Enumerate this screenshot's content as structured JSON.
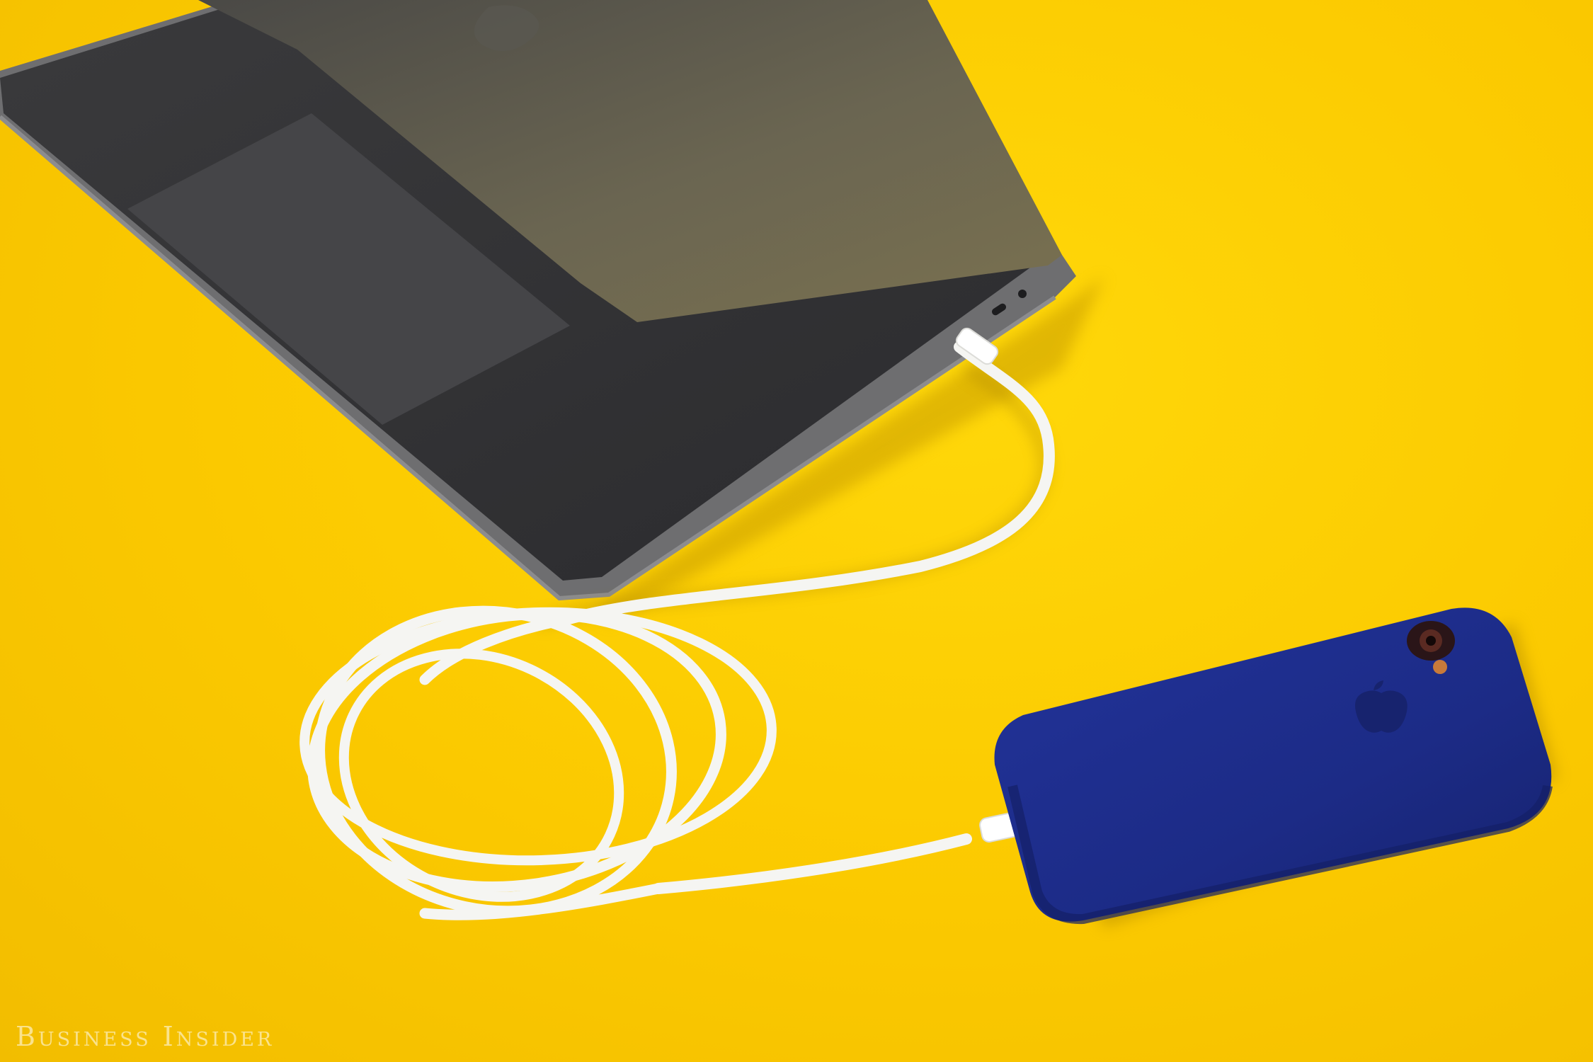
{
  "photo": {
    "background_color": "#f7c600",
    "laptop_color": "#55534e",
    "phone_case_color": "#1f2f8f",
    "cable_color": "#f4f4f0"
  },
  "watermark": {
    "text": "Business Insider"
  }
}
